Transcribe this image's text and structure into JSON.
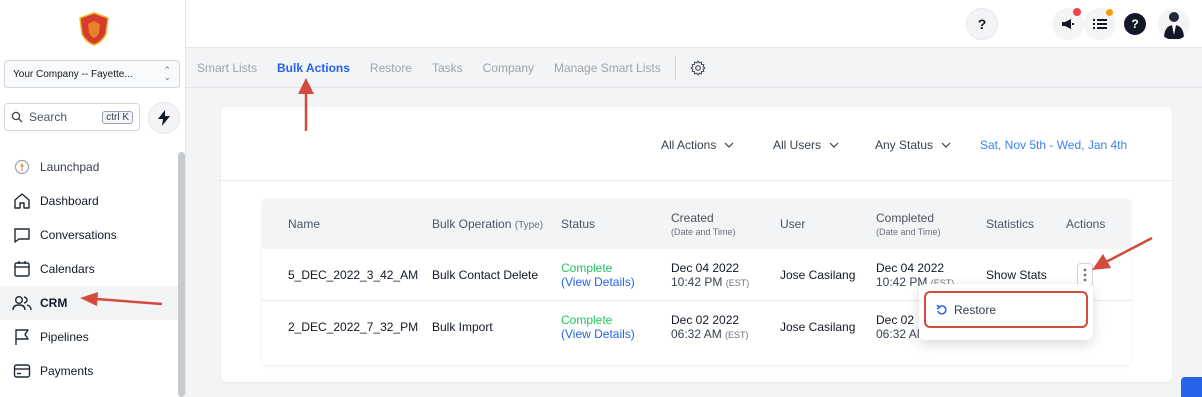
{
  "sidebar": {
    "company": "Your Company -- Fayette...",
    "search_label": "Search",
    "search_shortcut": "ctrl K",
    "items": [
      {
        "label": "Launchpad",
        "icon": "launchpad-icon"
      },
      {
        "label": "Dashboard",
        "icon": "home-icon"
      },
      {
        "label": "Conversations",
        "icon": "chat-icon"
      },
      {
        "label": "Calendars",
        "icon": "calendar-icon"
      },
      {
        "label": "CRM",
        "icon": "users-icon"
      },
      {
        "label": "Pipelines",
        "icon": "flag-icon"
      },
      {
        "label": "Payments",
        "icon": "card-icon"
      }
    ]
  },
  "topbar": {
    "help_label": "?"
  },
  "tabs": [
    {
      "label": "Smart Lists"
    },
    {
      "label": "Bulk Actions"
    },
    {
      "label": "Restore"
    },
    {
      "label": "Tasks"
    },
    {
      "label": "Company"
    },
    {
      "label": "Manage Smart Lists"
    }
  ],
  "filters": {
    "actions": "All Actions",
    "users": "All Users",
    "status": "Any Status",
    "date_range": "Sat, Nov 5th - Wed, Jan 4th"
  },
  "table": {
    "headers": {
      "name": "Name",
      "operation": "Bulk Operation",
      "operation_type": "(Type)",
      "status": "Status",
      "created": "Created",
      "created_sub": "(Date and Time)",
      "user": "User",
      "completed": "Completed",
      "completed_sub": "(Date and Time)",
      "statistics": "Statistics",
      "actions": "Actions"
    },
    "rows": [
      {
        "name": "5_DEC_2022_3_42_AM",
        "operation": "Bulk Contact Delete",
        "status": "Complete",
        "details": "(View Details)",
        "created_date": "Dec 04 2022",
        "created_time": "10:42 PM",
        "created_tz": "(EST)",
        "user": "Jose Casilang",
        "completed_date": "Dec 04 2022",
        "completed_time": "10:42 PM",
        "completed_tz": "(EST)",
        "statistics": "Show Stats"
      },
      {
        "name": "2_DEC_2022_7_32_PM",
        "operation": "Bulk Import",
        "status": "Complete",
        "details": "(View Details)",
        "created_date": "Dec 02 2022",
        "created_time": "06:32 AM",
        "created_tz": "(EST)",
        "user": "Jose Casilang",
        "completed_date": "Dec 02",
        "completed_time": "06:32 AM",
        "completed_tz": "",
        "statistics": ""
      }
    ]
  },
  "dropdown": {
    "restore_label": "Restore"
  },
  "colors": {
    "accent": "#2563eb",
    "success": "#22c55e",
    "annotation": "#d24b3c"
  }
}
